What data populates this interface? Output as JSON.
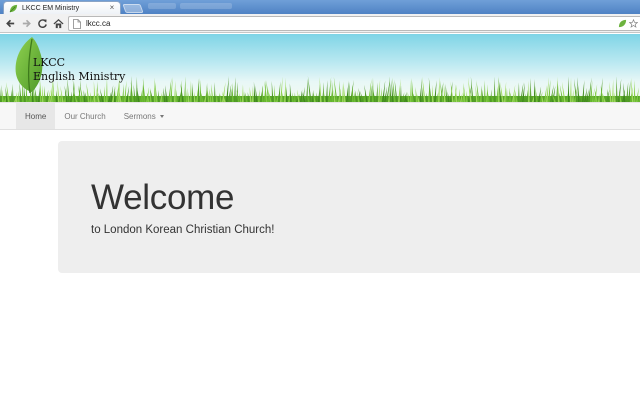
{
  "browser": {
    "tab_title": "LKCC EM Ministry",
    "tab_close": "×",
    "url": "lkcc.ca"
  },
  "site": {
    "logo_line1": "LKCC",
    "logo_line2": "English Ministry"
  },
  "nav": {
    "items": [
      {
        "label": "Home",
        "active": true
      },
      {
        "label": "Our Church",
        "active": false
      },
      {
        "label": "Sermons",
        "active": false,
        "dropdown": true
      }
    ]
  },
  "hero": {
    "heading": "Welcome",
    "subtext": "to London Korean Christian Church!"
  },
  "colors": {
    "leaf_green": "#6db33f",
    "jumbotron_bg": "#eeeeee",
    "nav_bg": "#f7f7f7"
  }
}
